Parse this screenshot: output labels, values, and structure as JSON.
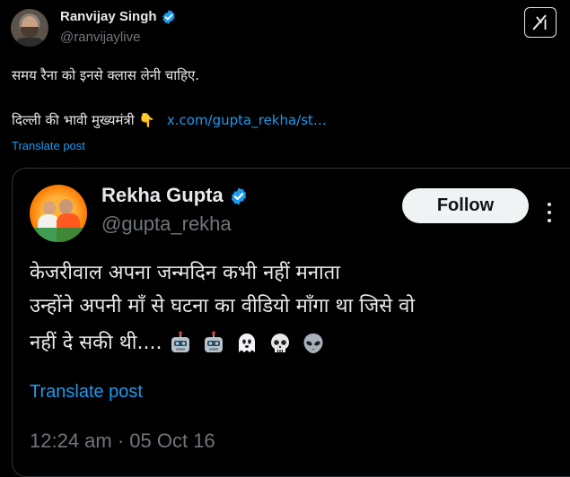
{
  "post": {
    "author_name": "Ranvijay Singh",
    "author_handle": "@ranvijaylive",
    "line1": "समय रैना को इनसे क्लास लेनी चाहिए.",
    "line2": "दिल्ली की भावी मुख्यमंत्री",
    "pointing_emoji": "👇",
    "link": "x.com/gupta_rekha/st…",
    "translate": "Translate post"
  },
  "quoted": {
    "author_name": "Rekha Gupta",
    "author_handle": "@gupta_rekha",
    "follow_label": "Follow",
    "line1": "केजरीवाल अपना जन्मदिन कभी नहीं मनाता",
    "line2": "उन्होंने अपनी माँ से घटना का वीडियो माँगा था जिसे वो",
    "line3": "नहीं दे सकी थी....",
    "emojis": [
      "robot",
      "robot",
      "ghost",
      "skull",
      "alien"
    ],
    "translate": "Translate post",
    "timestamp": "12:24 am · 05 Oct 16"
  },
  "colors": {
    "background": "#000000",
    "text": "#e7e9ea",
    "secondary": "#71767b",
    "link": "#1d9bf0",
    "verified": "#1d9bf0",
    "border": "#2f3336"
  }
}
